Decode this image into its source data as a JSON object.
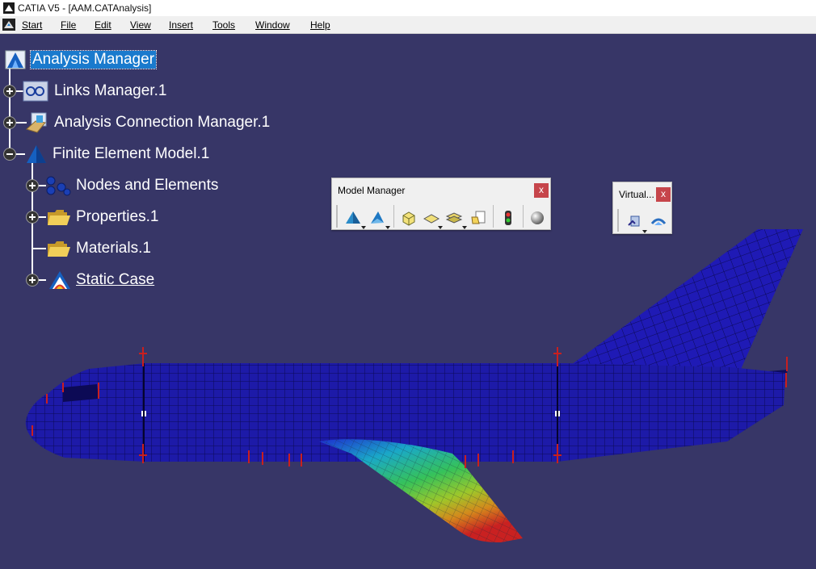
{
  "window": {
    "title": "CATIA V5 - [AAM.CATAnalysis]"
  },
  "menubar": {
    "items": [
      {
        "label": "Start"
      },
      {
        "label": "File"
      },
      {
        "label": "Edit"
      },
      {
        "label": "View"
      },
      {
        "label": "Insert"
      },
      {
        "label": "Tools"
      },
      {
        "label": "Window"
      },
      {
        "label": "Help"
      }
    ]
  },
  "tree": {
    "root": "Analysis Manager",
    "links_manager": "Links Manager.1",
    "connection_manager": "Analysis Connection Manager.1",
    "fem": "Finite Element Model.1",
    "nodes_elements": "Nodes and Elements",
    "properties": "Properties.1",
    "materials": "Materials.1",
    "static_case": "Static Case"
  },
  "toolbars": {
    "model_manager": {
      "title": "Model Manager",
      "close": "x"
    },
    "virtual": {
      "title": "Virtual...",
      "close": "x"
    }
  },
  "colors": {
    "background": "#373667",
    "mesh_blue": "#1d1aa8",
    "selection": "#1a7acd",
    "restraint_red": "#c91f1f"
  },
  "icons": {
    "root": "analysis-manager-icon",
    "links": "links-manager-icon",
    "connection": "connection-manager-icon",
    "fem": "fem-icon",
    "nodes": "nodes-elements-icon",
    "folder": "folder-icon",
    "static_case": "static-case-icon"
  }
}
